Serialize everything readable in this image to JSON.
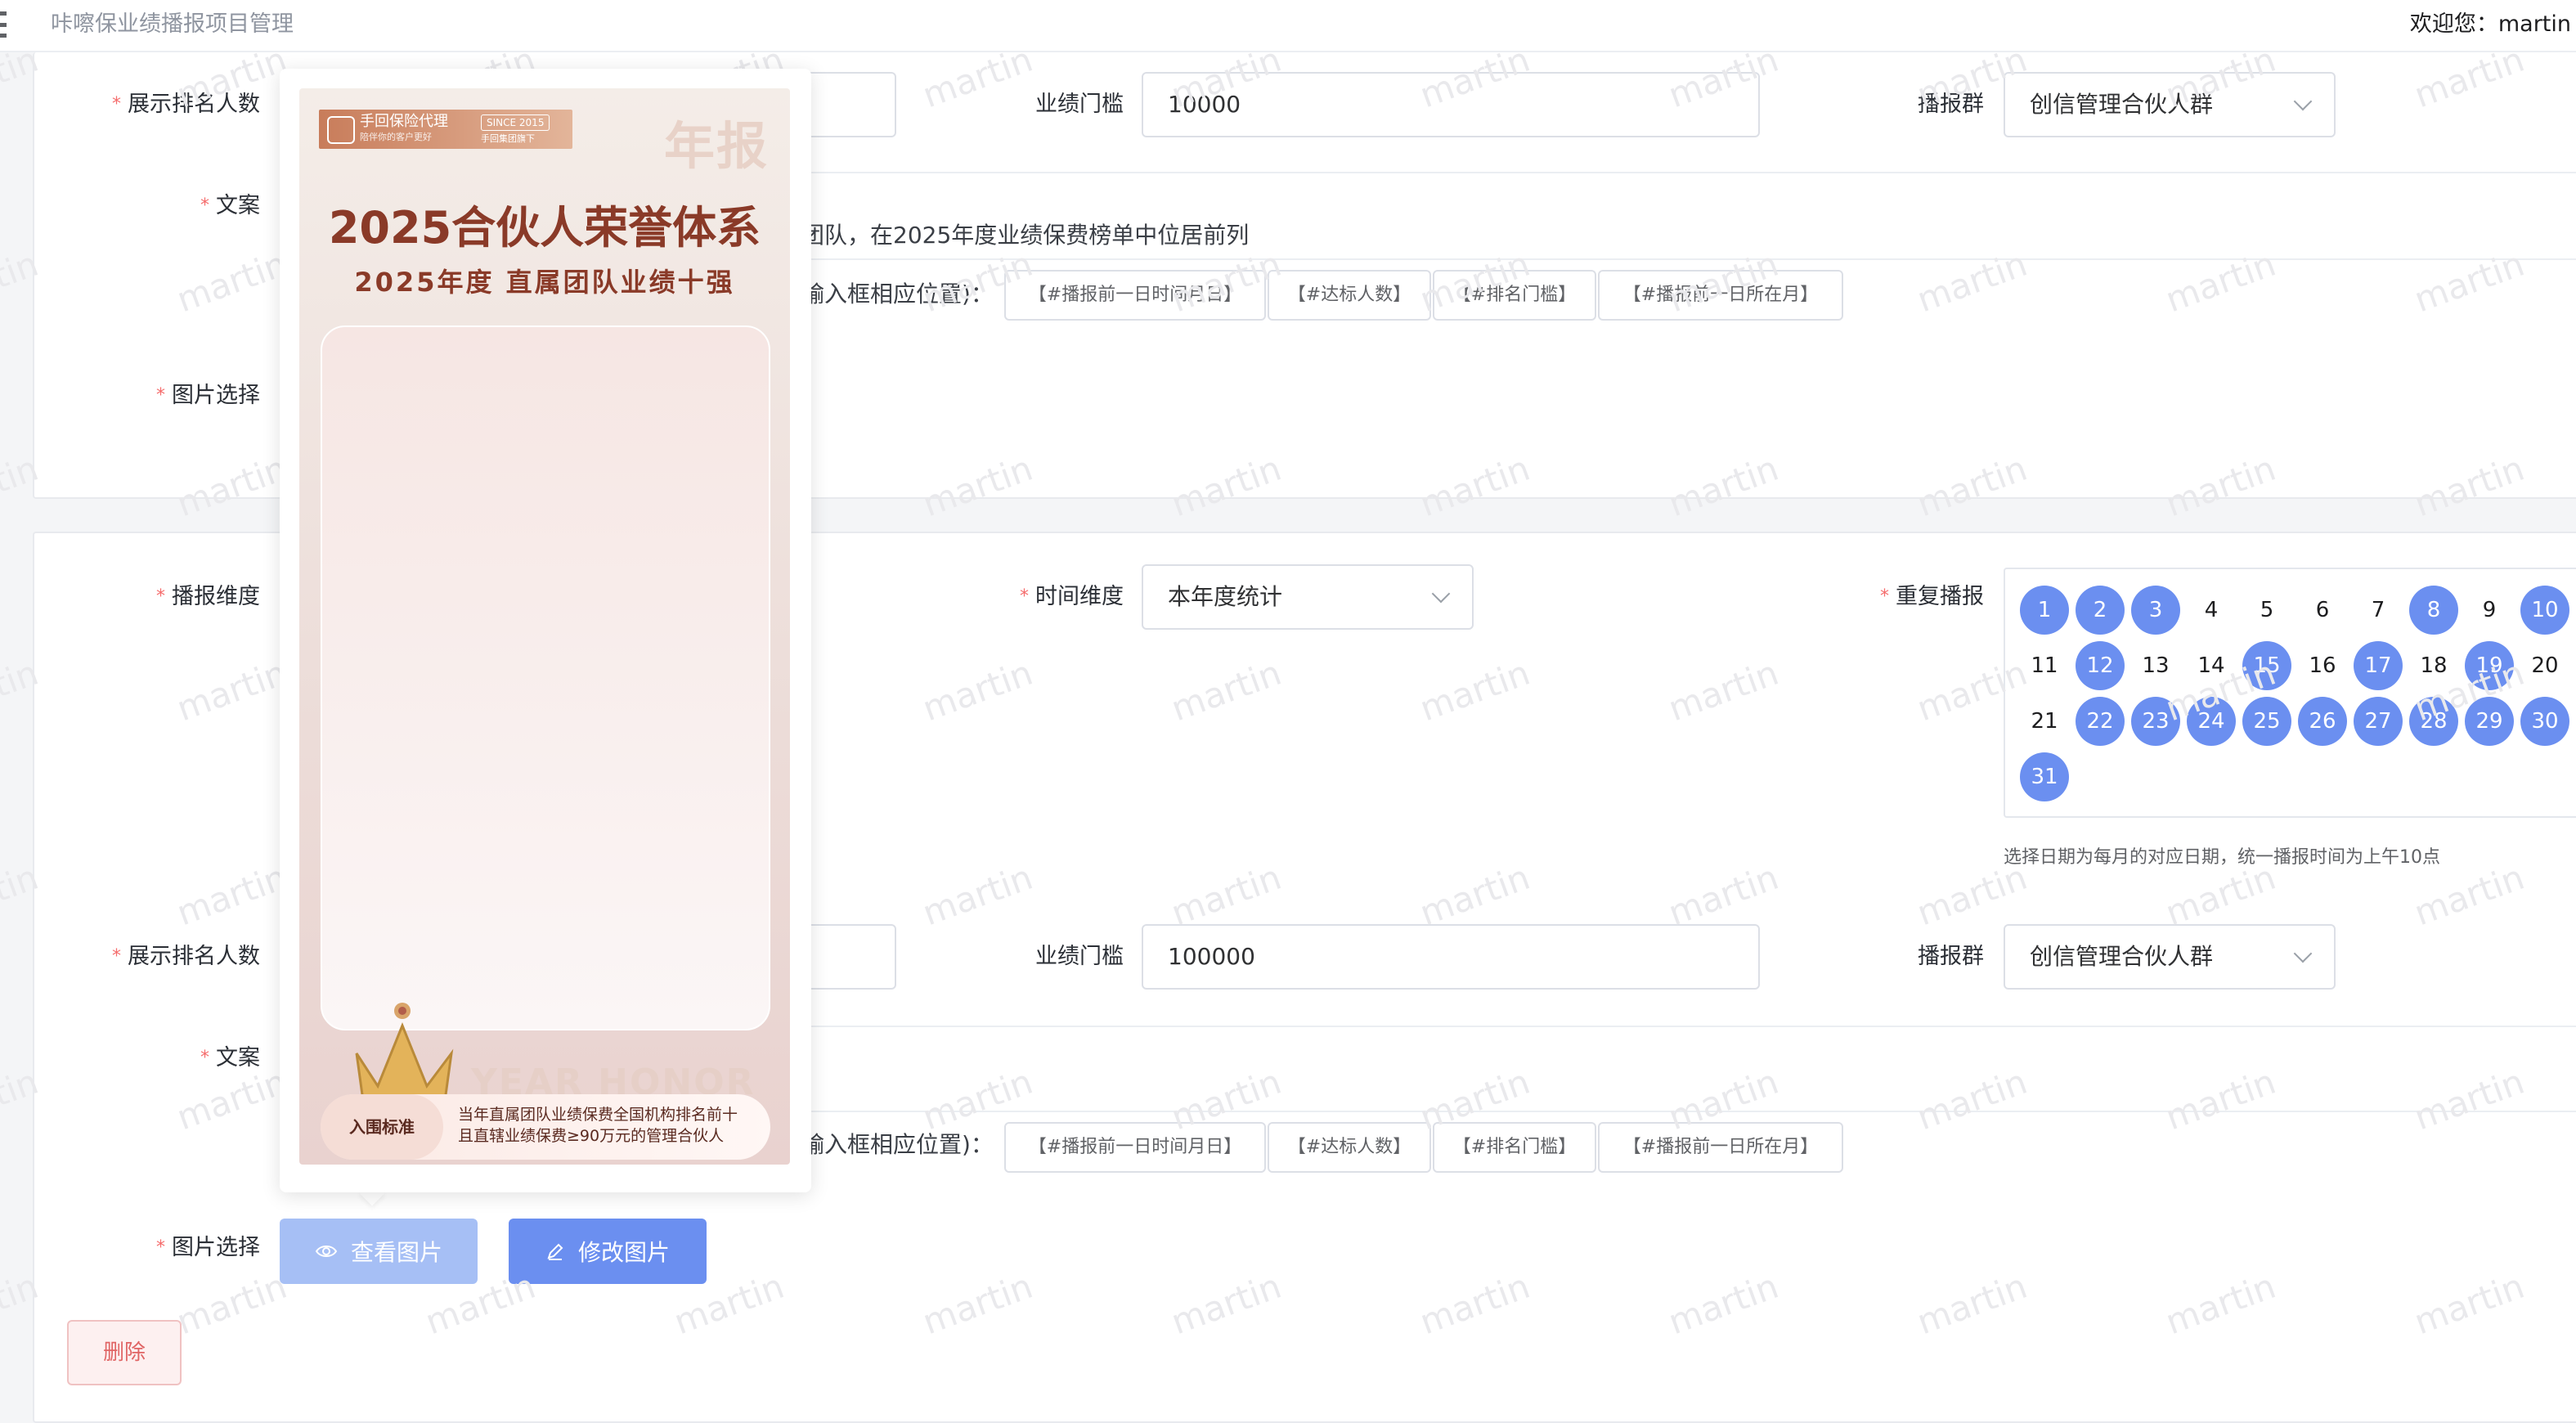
{
  "header": {
    "title": "咔嚓保业绩播报项目管理",
    "welcome": "欢迎您：martin"
  },
  "watermark": "martin",
  "block1": {
    "rank_label": "展示排名人数",
    "threshold_label": "业绩门槛",
    "threshold_value": "10000",
    "group_label": "播报群",
    "group_value": "创信管理合伙人群",
    "copy_label": "文案",
    "copy_text_fragment": "团队，在2025年度业绩保费榜单中位居前列",
    "insert_hint_fragment": "输入框相应位置)：",
    "vars": [
      "【#播报前一日时间月日】",
      "【#达标人数】",
      "【#排名门槛】",
      "【#播报前一日所在月】"
    ],
    "image_label": "图片选择"
  },
  "block2": {
    "dimension_label": "播报维度",
    "time_dim_label": "时间维度",
    "time_dim_value": "本年度统计",
    "repeat_label": "重复播报",
    "days": [
      {
        "d": "1",
        "sel": true
      },
      {
        "d": "2",
        "sel": true
      },
      {
        "d": "3",
        "sel": true
      },
      {
        "d": "4",
        "sel": false
      },
      {
        "d": "5",
        "sel": false
      },
      {
        "d": "6",
        "sel": false
      },
      {
        "d": "7",
        "sel": false
      },
      {
        "d": "8",
        "sel": true
      },
      {
        "d": "9",
        "sel": false
      },
      {
        "d": "10",
        "sel": true
      },
      {
        "d": "11",
        "sel": false
      },
      {
        "d": "12",
        "sel": true
      },
      {
        "d": "13",
        "sel": false
      },
      {
        "d": "14",
        "sel": false
      },
      {
        "d": "15",
        "sel": true
      },
      {
        "d": "16",
        "sel": false
      },
      {
        "d": "17",
        "sel": true
      },
      {
        "d": "18",
        "sel": false
      },
      {
        "d": "19",
        "sel": true
      },
      {
        "d": "20",
        "sel": false
      },
      {
        "d": "21",
        "sel": false
      },
      {
        "d": "22",
        "sel": true
      },
      {
        "d": "23",
        "sel": true
      },
      {
        "d": "24",
        "sel": true
      },
      {
        "d": "25",
        "sel": true
      },
      {
        "d": "26",
        "sel": true
      },
      {
        "d": "27",
        "sel": true
      },
      {
        "d": "28",
        "sel": true
      },
      {
        "d": "29",
        "sel": true
      },
      {
        "d": "30",
        "sel": true
      },
      {
        "d": "31",
        "sel": true
      }
    ],
    "repeat_hint": "选择日期为每月的对应日期，统一播报时间为上午10点",
    "rank_label": "展示排名人数",
    "threshold_label": "业绩门槛",
    "threshold_value": "100000",
    "group_label": "播报群",
    "group_value": "创信管理合伙人群",
    "copy_label": "文案",
    "insert_hint_fragment": "输入框相应位置)：",
    "vars": [
      "【#播报前一日时间月日】",
      "【#达标人数】",
      "【#排名门槛】",
      "【#播报前一日所在月】"
    ],
    "image_label": "图片选择",
    "view_button": "查看图片",
    "edit_button": "修改图片",
    "delete_button": "删除"
  },
  "poster": {
    "brand_name": "手回保险代理",
    "brand_sub": "陪伴你的客户更好",
    "brand_tag": "SINCE 2015",
    "brand_tag2": "手回集团旗下",
    "corner_text": "年报",
    "title": "2025合伙人荣誉体系",
    "subtitle": "2025年度 直属团队业绩十强",
    "watermark_en": "YEAR HONOR",
    "criteria_label": "入围标准",
    "criteria_line1": "当年直属团队业绩保费全国机构排名前十",
    "criteria_line2": "且直辖业绩保费≥90万元的管理合伙人"
  },
  "colors": {
    "primary": "#6b8ff0",
    "primary_light": "#a6bff5",
    "danger": "#e06464",
    "required": "#f56c6c"
  }
}
